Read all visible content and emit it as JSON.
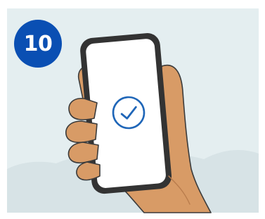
{
  "step": {
    "number": "10"
  },
  "colors": {
    "background": "#e4eef0",
    "hills": "#d7e3e6",
    "badge": "#0a4fb3",
    "phone_frame": "#333333",
    "phone_screen": "#ffffff",
    "check": "#1f66b8",
    "skin": "#d89b66",
    "skin_shadow": "#b97c4c",
    "outline": "#3b3b3b"
  },
  "icons": {
    "status": "check-circle-icon"
  }
}
